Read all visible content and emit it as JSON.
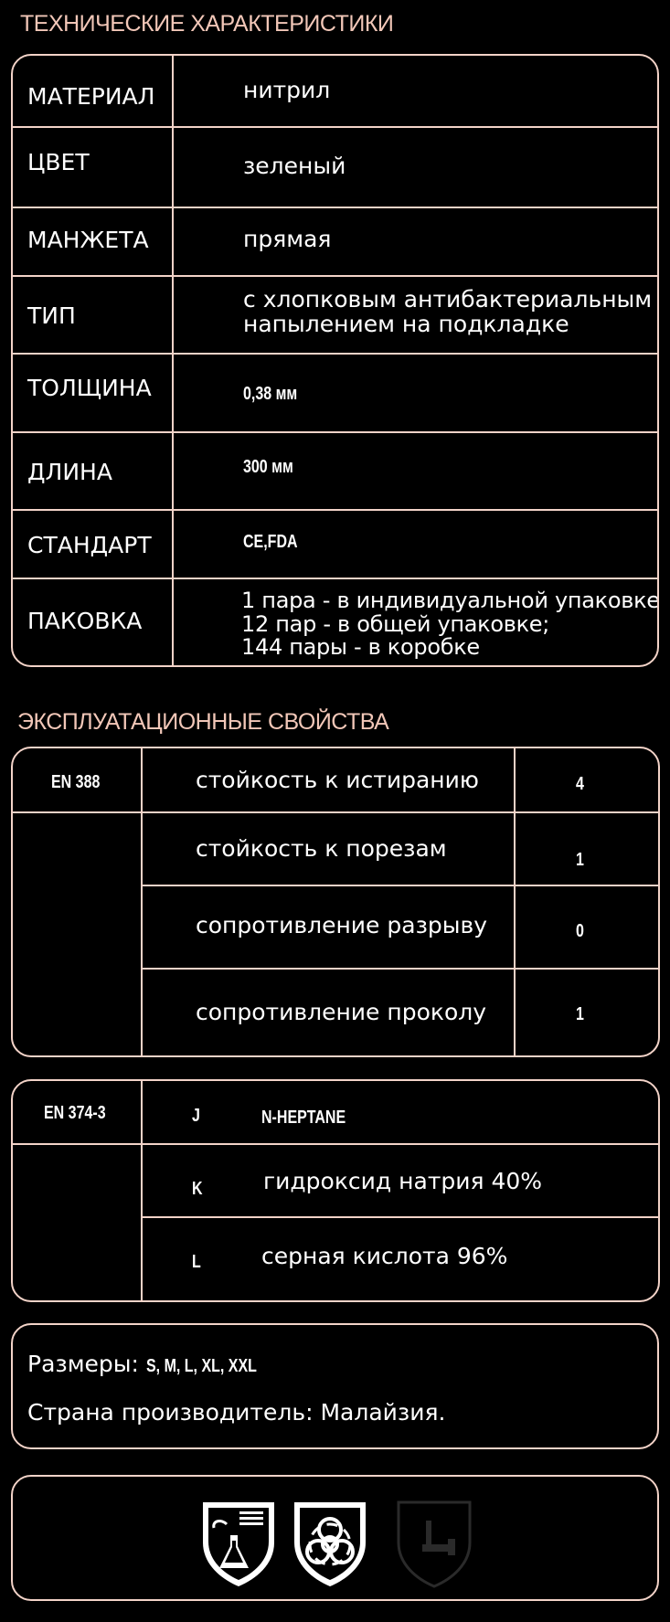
{
  "tech": {
    "title": "ТЕХНИЧЕСКИЕ ХАРАКТЕРИСТИКИ",
    "rows": [
      {
        "label": "МАТЕРИАЛ",
        "value": "нитрил"
      },
      {
        "label": "ЦВЕТ",
        "value": "зеленый"
      },
      {
        "label": "МАНЖЕТА",
        "value": "прямая"
      },
      {
        "label": "ТИП",
        "value_lines": [
          "с хлопковым антибактериальным",
          "напылением на подкладке"
        ]
      },
      {
        "label": "ТОЛЩИНА",
        "value": "0,38 мм"
      },
      {
        "label": "ДЛИНА",
        "value": "300 мм"
      },
      {
        "label": "СТАНДАРТ",
        "value": "CE,FDA"
      },
      {
        "label": "ПАКОВКА",
        "value_lines": [
          "1 пара - в индивидуальной упаковке;",
          "12 пар - в общей упаковке;",
          "144 пары - в коробке"
        ]
      }
    ]
  },
  "performance": {
    "title": "ЭКСПЛУАТАЦИОННЫЕ СВОЙСТВА",
    "en388": {
      "standard": "EN 388",
      "rows": [
        {
          "property": "стойкость к истиранию",
          "level": "4"
        },
        {
          "property": "стойкость к порезам",
          "level": "1"
        },
        {
          "property": "сопротивление разрыву",
          "level": "0"
        },
        {
          "property": "сопротивление проколу",
          "level": "1"
        }
      ]
    },
    "en374": {
      "standard": "EN 374-3",
      "rows": [
        {
          "code": "J",
          "chemical": "N-HEPTANE"
        },
        {
          "code": "K",
          "chemical": "гидроксид натрия 40%"
        },
        {
          "code": "L",
          "chemical": "серная кислота 96%"
        }
      ]
    }
  },
  "info": {
    "sizes_label": "Размеры:",
    "sizes_value": "S, M, L, XL, XXL",
    "country_label": "Страна производитель:",
    "country_value": "Малайзия."
  },
  "icons": [
    "chemical-protection-icon",
    "biohazard-icon",
    "mechanical-protection-icon"
  ],
  "colors": {
    "accent": "#f2c7b8",
    "border": "#f3d3c8",
    "background": "#000000"
  }
}
